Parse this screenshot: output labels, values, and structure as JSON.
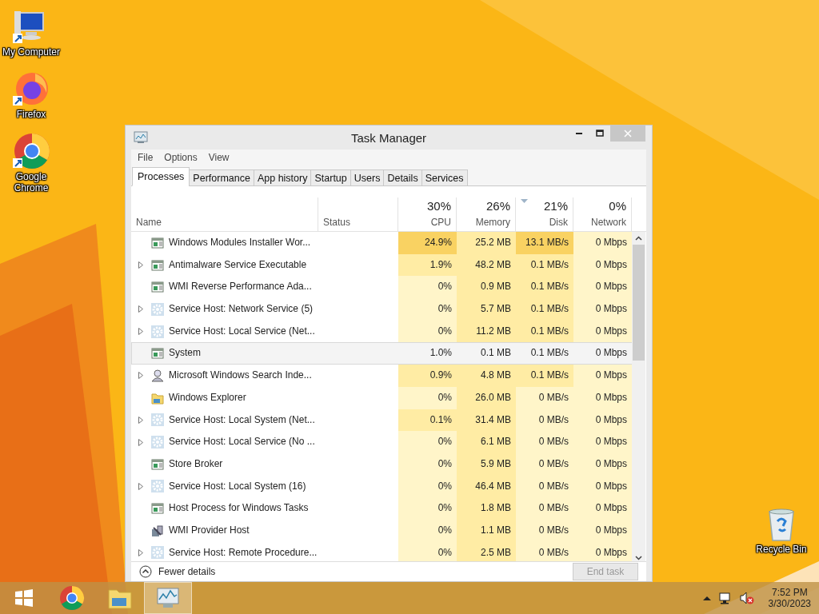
{
  "desktop_icons": [
    {
      "kind": "computer",
      "label": "My Computer"
    },
    {
      "kind": "firefox",
      "label": "Firefox"
    },
    {
      "kind": "chrome",
      "label": "Google Chrome"
    },
    {
      "kind": "recycle",
      "label": "Recycle Bin"
    }
  ],
  "window": {
    "title": "Task Manager",
    "menu": [
      "File",
      "Options",
      "View"
    ],
    "tabs": [
      {
        "label": "Processes",
        "selected": true
      },
      {
        "label": "Performance",
        "selected": false
      },
      {
        "label": "App history",
        "selected": false
      },
      {
        "label": "Startup",
        "selected": false
      },
      {
        "label": "Users",
        "selected": false
      },
      {
        "label": "Details",
        "selected": false
      },
      {
        "label": "Services",
        "selected": false
      }
    ],
    "name_column": "Name",
    "status_column": "Status",
    "metric_columns": [
      {
        "percent": "30%",
        "label": "CPU",
        "sorted": false
      },
      {
        "percent": "26%",
        "label": "Memory",
        "sorted": false
      },
      {
        "percent": "21%",
        "label": "Disk",
        "sorted": true
      },
      {
        "percent": "0%",
        "label": "Network",
        "sorted": false
      }
    ],
    "rows": [
      {
        "name": "Windows Modules Installer Wor...",
        "kind": "app",
        "expandable": false,
        "selected": false,
        "cells": [
          {
            "text": "24.9%",
            "color": "#f9d262"
          },
          {
            "text": "25.2 MB",
            "color": "#ffeca4"
          },
          {
            "text": "13.1 MB/s",
            "color": "#f9d262"
          },
          {
            "text": "0 Mbps",
            "color": "#fff5c9"
          }
        ]
      },
      {
        "name": "Antimalware Service Executable",
        "kind": "app",
        "expandable": true,
        "selected": false,
        "cells": [
          {
            "text": "1.9%",
            "color": "#ffeca4"
          },
          {
            "text": "48.2 MB",
            "color": "#ffeca4"
          },
          {
            "text": "0.1 MB/s",
            "color": "#ffeca4"
          },
          {
            "text": "0 Mbps",
            "color": "#fff5c9"
          }
        ]
      },
      {
        "name": "WMI Reverse Performance Ada...",
        "kind": "app",
        "expandable": false,
        "selected": false,
        "cells": [
          {
            "text": "0%",
            "color": "#fff5c9"
          },
          {
            "text": "0.9 MB",
            "color": "#ffeca4"
          },
          {
            "text": "0.1 MB/s",
            "color": "#ffeca4"
          },
          {
            "text": "0 Mbps",
            "color": "#fff5c9"
          }
        ]
      },
      {
        "name": "Service Host: Network Service (5)",
        "kind": "service",
        "expandable": true,
        "selected": false,
        "cells": [
          {
            "text": "0%",
            "color": "#fff5c9"
          },
          {
            "text": "5.7 MB",
            "color": "#ffeca4"
          },
          {
            "text": "0.1 MB/s",
            "color": "#ffeca4"
          },
          {
            "text": "0 Mbps",
            "color": "#fff5c9"
          }
        ]
      },
      {
        "name": "Service Host: Local Service (Net...",
        "kind": "service",
        "expandable": true,
        "selected": false,
        "cells": [
          {
            "text": "0%",
            "color": "#fff5c9"
          },
          {
            "text": "11.2 MB",
            "color": "#ffeca4"
          },
          {
            "text": "0.1 MB/s",
            "color": "#ffeca4"
          },
          {
            "text": "0 Mbps",
            "color": "#fff5c9"
          }
        ]
      },
      {
        "name": "System",
        "kind": "app",
        "expandable": false,
        "selected": true,
        "cells": [
          {
            "text": "1.0%",
            "color": "#f4f4f4"
          },
          {
            "text": "0.1 MB",
            "color": "#f4f4f4"
          },
          {
            "text": "0.1 MB/s",
            "color": "#f4f4f4"
          },
          {
            "text": "0 Mbps",
            "color": "#f4f4f4"
          }
        ]
      },
      {
        "name": "Microsoft Windows Search Inde...",
        "kind": "indexer",
        "expandable": true,
        "selected": false,
        "cells": [
          {
            "text": "0.9%",
            "color": "#ffeca4"
          },
          {
            "text": "4.8 MB",
            "color": "#ffeca4"
          },
          {
            "text": "0.1 MB/s",
            "color": "#ffeca4"
          },
          {
            "text": "0 Mbps",
            "color": "#fff5c9"
          }
        ]
      },
      {
        "name": "Windows Explorer",
        "kind": "explorer",
        "expandable": false,
        "selected": false,
        "cells": [
          {
            "text": "0%",
            "color": "#fff5c9"
          },
          {
            "text": "26.0 MB",
            "color": "#ffeca4"
          },
          {
            "text": "0 MB/s",
            "color": "#fff5c9"
          },
          {
            "text": "0 Mbps",
            "color": "#fff5c9"
          }
        ]
      },
      {
        "name": "Service Host: Local System (Net...",
        "kind": "service",
        "expandable": true,
        "selected": false,
        "cells": [
          {
            "text": "0.1%",
            "color": "#ffeca4"
          },
          {
            "text": "31.4 MB",
            "color": "#ffeca4"
          },
          {
            "text": "0 MB/s",
            "color": "#fff5c9"
          },
          {
            "text": "0 Mbps",
            "color": "#fff5c9"
          }
        ]
      },
      {
        "name": "Service Host: Local Service (No ...",
        "kind": "service",
        "expandable": true,
        "selected": false,
        "cells": [
          {
            "text": "0%",
            "color": "#fff5c9"
          },
          {
            "text": "6.1 MB",
            "color": "#ffeca4"
          },
          {
            "text": "0 MB/s",
            "color": "#fff5c9"
          },
          {
            "text": "0 Mbps",
            "color": "#fff5c9"
          }
        ]
      },
      {
        "name": "Store Broker",
        "kind": "app",
        "expandable": false,
        "selected": false,
        "cells": [
          {
            "text": "0%",
            "color": "#fff5c9"
          },
          {
            "text": "5.9 MB",
            "color": "#ffeca4"
          },
          {
            "text": "0 MB/s",
            "color": "#fff5c9"
          },
          {
            "text": "0 Mbps",
            "color": "#fff5c9"
          }
        ]
      },
      {
        "name": "Service Host: Local System (16)",
        "kind": "service",
        "expandable": true,
        "selected": false,
        "cells": [
          {
            "text": "0%",
            "color": "#fff5c9"
          },
          {
            "text": "46.4 MB",
            "color": "#ffeca4"
          },
          {
            "text": "0 MB/s",
            "color": "#fff5c9"
          },
          {
            "text": "0 Mbps",
            "color": "#fff5c9"
          }
        ]
      },
      {
        "name": "Host Process for Windows Tasks",
        "kind": "app",
        "expandable": false,
        "selected": false,
        "cells": [
          {
            "text": "0%",
            "color": "#fff5c9"
          },
          {
            "text": "1.8 MB",
            "color": "#ffeca4"
          },
          {
            "text": "0 MB/s",
            "color": "#fff5c9"
          },
          {
            "text": "0 Mbps",
            "color": "#fff5c9"
          }
        ]
      },
      {
        "name": "WMI Provider Host",
        "kind": "wmi",
        "expandable": false,
        "selected": false,
        "cells": [
          {
            "text": "0%",
            "color": "#fff5c9"
          },
          {
            "text": "1.1 MB",
            "color": "#ffeca4"
          },
          {
            "text": "0 MB/s",
            "color": "#fff5c9"
          },
          {
            "text": "0 Mbps",
            "color": "#fff5c9"
          }
        ]
      },
      {
        "name": "Service Host: Remote Procedure...",
        "kind": "service",
        "expandable": true,
        "selected": false,
        "cells": [
          {
            "text": "0%",
            "color": "#fff5c9"
          },
          {
            "text": "2.5 MB",
            "color": "#ffeca4"
          },
          {
            "text": "0 MB/s",
            "color": "#fff5c9"
          },
          {
            "text": "0 Mbps",
            "color": "#fff5c9"
          }
        ]
      }
    ],
    "footer": {
      "details_link": "Fewer details",
      "end_task": {
        "label": "End task",
        "disabled": true
      }
    }
  },
  "taskbar": {
    "apps": [
      {
        "kind": "start",
        "active": false
      },
      {
        "kind": "chrome",
        "active": false
      },
      {
        "kind": "explorer",
        "active": false
      },
      {
        "kind": "taskmgr",
        "active": true
      }
    ],
    "tray": {
      "time": "7:52 PM",
      "date": "3/30/2023"
    }
  }
}
